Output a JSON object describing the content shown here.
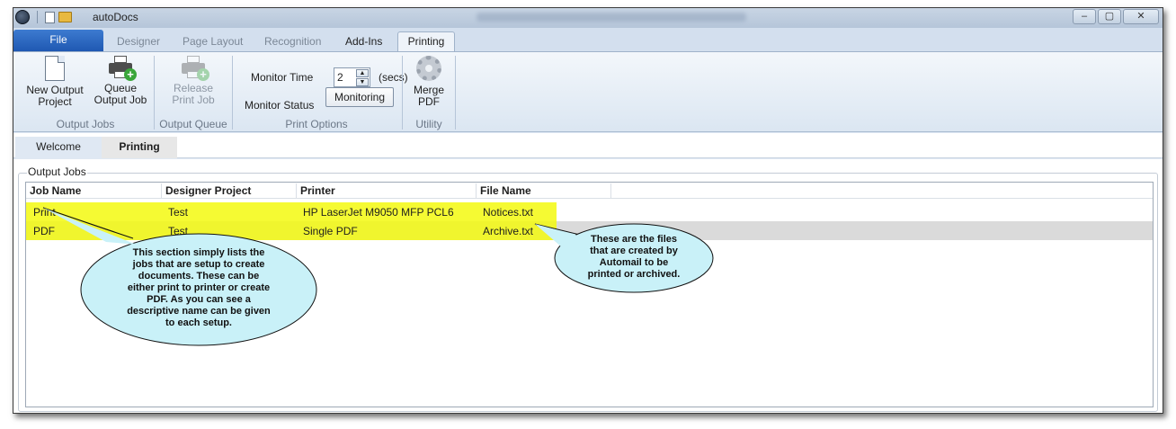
{
  "window": {
    "app_title": "autoDocs",
    "buttons": {
      "minimize": "‒",
      "maximize": "▢",
      "close": "✕"
    }
  },
  "ribbon_tabs": {
    "file": "File",
    "designer": "Designer",
    "page_layout": "Page Layout",
    "recognition": "Recognition",
    "add_ins": "Add-Ins",
    "printing": "Printing"
  },
  "ribbon": {
    "output_jobs": {
      "label": "Output Jobs",
      "new_output_project": [
        "New Output",
        "Project"
      ],
      "queue_output_job": [
        "Queue",
        "Output Job"
      ]
    },
    "output_queue": {
      "label": "Output Queue",
      "release_print_job": [
        "Release",
        "Print Job"
      ]
    },
    "print_options": {
      "label": "Print Options",
      "monitor_time_label": "Monitor Time",
      "monitor_time_value": "2",
      "monitor_time_unit": "(secs)",
      "monitor_status_label": "Monitor Status",
      "monitoring_button": "Monitoring"
    },
    "utility": {
      "label": "Utility",
      "merge_pdf": [
        "Merge",
        "PDF"
      ]
    }
  },
  "doc_tabs": {
    "welcome": "Welcome",
    "printing": "Printing"
  },
  "output_jobs": {
    "legend": "Output Jobs",
    "columns": [
      "Job Name",
      "Designer Project",
      "Printer",
      "File Name"
    ],
    "rows": [
      {
        "job_name": "Print",
        "designer_project": "Test",
        "printer": "HP LaserJet M9050 MFP PCL6",
        "file_name": "Notices.txt"
      },
      {
        "job_name": "PDF",
        "designer_project": "Test",
        "printer": "Single PDF",
        "file_name": "Archive.txt"
      }
    ]
  },
  "callouts": {
    "jobs": [
      "This section simply lists the",
      "jobs that are setup to create",
      "documents. These can be",
      "either print to printer or create",
      "PDF. As you can see a",
      "descriptive name can be given",
      "to each setup."
    ],
    "files": [
      "These are the files",
      "that are created by",
      "Automail to be",
      "printed or archived."
    ]
  },
  "colors": {
    "highlight": "#f3f90f",
    "callout_fill": "#c9f1f8",
    "file_tab": "#2a66c2"
  }
}
